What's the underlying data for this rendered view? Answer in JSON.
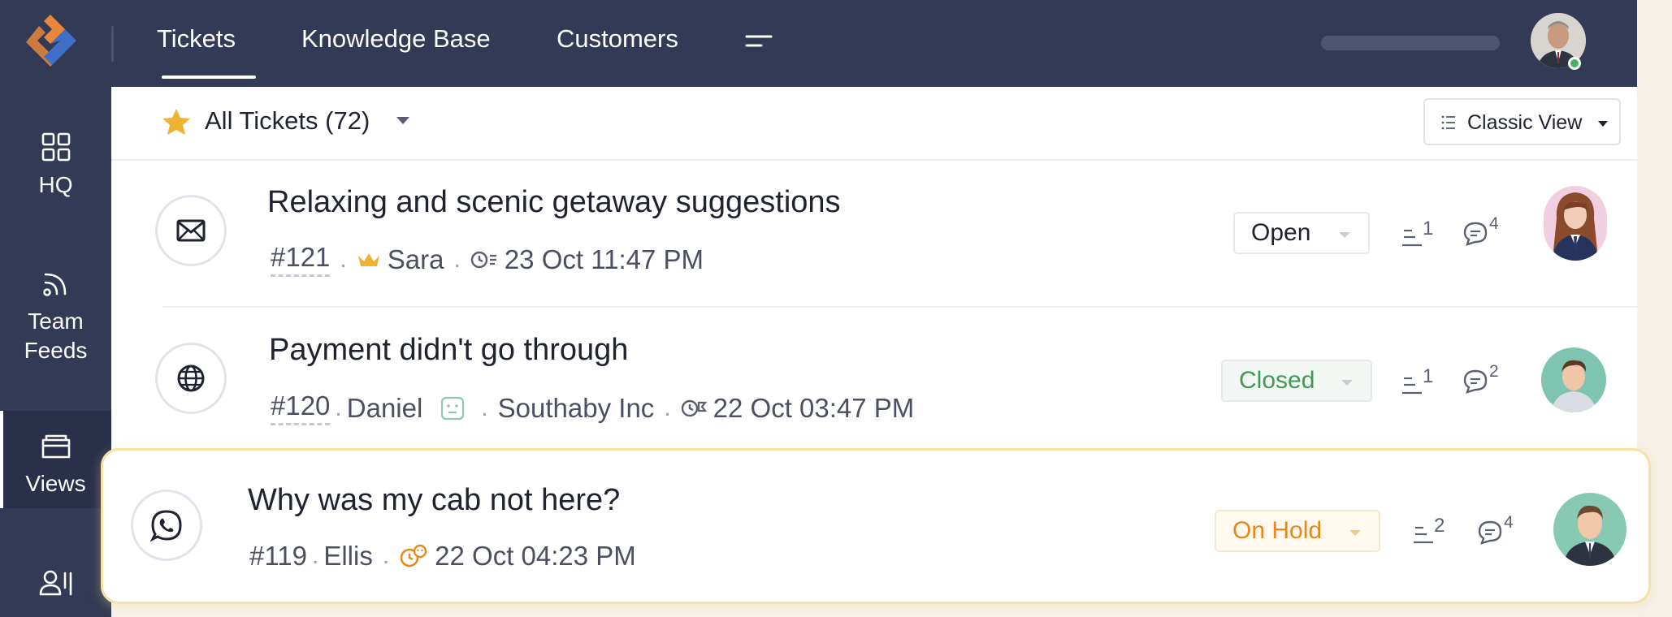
{
  "topnav": {
    "tabs": [
      "Tickets",
      "Knowledge Base",
      "Customers"
    ]
  },
  "sidebar": {
    "items": [
      {
        "label": "HQ",
        "icon": "grid-icon"
      },
      {
        "label_line1": "Team",
        "label_line2": "Feeds",
        "icon": "feeds-icon"
      },
      {
        "label": "Views",
        "icon": "folder-icon"
      },
      {
        "label": "",
        "icon": "contacts-icon"
      }
    ]
  },
  "filter": {
    "title": "All Tickets (72)",
    "view_label": "Classic View"
  },
  "tickets": [
    {
      "channel": "email",
      "subject": "Relaxing and scenic getaway suggestions",
      "id": "#121",
      "contact": "Sara",
      "account": "",
      "datetime": "23 Oct 11:47 PM",
      "status": "Open",
      "status_color": "#1f2330",
      "threads": "1",
      "comments": "4"
    },
    {
      "channel": "web",
      "subject": "Payment didn't go through",
      "id": "#120",
      "contact": "Daniel",
      "account": "Southaby Inc",
      "datetime": "22 Oct 03:47 PM",
      "status": "Closed",
      "status_color": "#3f9a54",
      "threads": "1",
      "comments": "2"
    },
    {
      "channel": "whatsapp",
      "subject": "Why was my cab not here?",
      "id": "#119",
      "contact": "Ellis",
      "account": "",
      "datetime": "22 Oct 04:23 PM",
      "status": "On Hold",
      "status_color": "#e38a1b",
      "threads": "2",
      "comments": "4"
    }
  ],
  "colors": {
    "nav_bg": "#323a56",
    "accent_orange": "#e9863a",
    "accent_blue": "#3f6fc6",
    "star": "#f0b233",
    "highlight_border": "#f3e1a6"
  }
}
